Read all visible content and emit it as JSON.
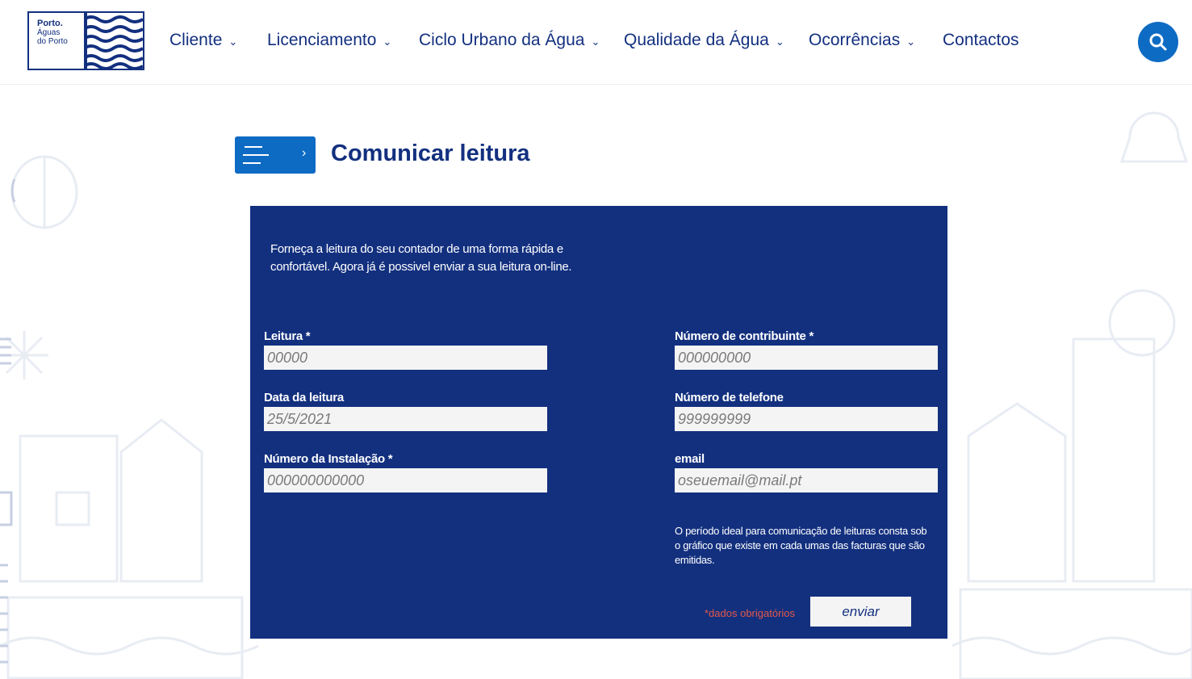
{
  "header": {
    "logo": {
      "brand": "Porto.",
      "line1": "Águas",
      "line2": "do Porto"
    },
    "nav": [
      {
        "label": "Cliente",
        "has_dropdown": true
      },
      {
        "label": "Licenciamento",
        "has_dropdown": true
      },
      {
        "label": "Ciclo Urbano da Água",
        "has_dropdown": true
      },
      {
        "label": "Qualidade da Água",
        "has_dropdown": true
      },
      {
        "label": "Ocorrências",
        "has_dropdown": true
      },
      {
        "label": "Contactos",
        "has_dropdown": false
      }
    ],
    "dropdown_glyph": "⌄",
    "search_icon": "search-icon"
  },
  "page": {
    "menu_toggle_arrow": "›",
    "title": "Comunicar leitura"
  },
  "form": {
    "intro": "Forneça a leitura do seu contador de uma forma rápida e confortável. Agora já é possivel enviar a sua leitura on-line.",
    "leitura": {
      "label": "Leitura *",
      "placeholder": "00000"
    },
    "data_leitura": {
      "label": "Data da leitura",
      "placeholder": "25/5/2021"
    },
    "numero_instalacao": {
      "label": "Número da Instalação *",
      "placeholder": "000000000000"
    },
    "numero_contribuinte": {
      "label": "Número de contribuinte *",
      "placeholder": "000000000"
    },
    "numero_telefone": {
      "label": "Número de telefone",
      "placeholder": "999999999"
    },
    "email": {
      "label": "email",
      "placeholder": "oseuemail@mail.pt"
    },
    "note": "O período ideal para comunicação de leituras consta sob o gráfico que existe em cada umas das facturas que são emitidas.",
    "required_note": "*dados obrigatórios",
    "submit_label": "enviar"
  },
  "colors": {
    "brand_navy": "#13307f",
    "accent_blue": "#0e6bc4",
    "required_red": "#e2584a",
    "input_bg": "#f4f4f4"
  }
}
